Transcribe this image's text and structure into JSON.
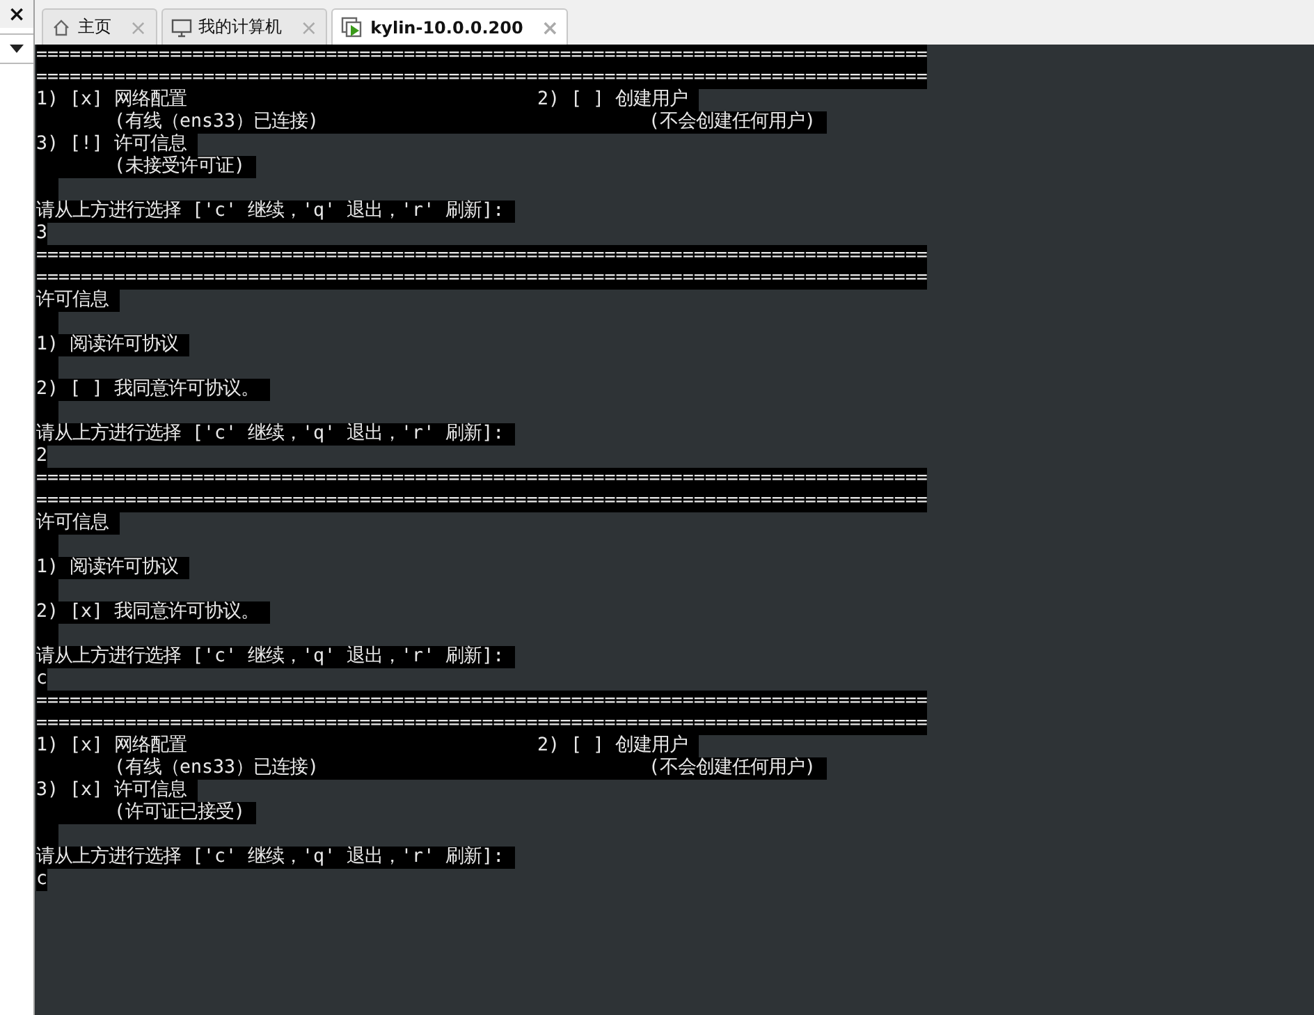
{
  "side_panel": {
    "close": "×"
  },
  "tabs": [
    {
      "label": "主页",
      "selected": false,
      "close": "×"
    },
    {
      "label": "我的计算机",
      "selected": false,
      "close": "×"
    },
    {
      "label": "kylin-10.0.0.200",
      "selected": true,
      "close": "×"
    }
  ],
  "terminal": {
    "lines": [
      {
        "kind": "rule",
        "text": "================================================================================"
      },
      {
        "kind": "rule",
        "text": "================================================================================"
      },
      {
        "kind": "item",
        "text": "1) [x] 网络配置",
        "column_2": "2) [ ] 创建用户"
      },
      {
        "kind": "detail",
        "text": "(有线（ens33）已连接)",
        "column_2": "(不会创建任何用户)"
      },
      {
        "kind": "item",
        "text": "3) [!] 许可信息"
      },
      {
        "kind": "detail",
        "text": "(未接受许可证)"
      },
      {
        "kind": "blank"
      },
      {
        "kind": "text",
        "text": "请从上方进行选择 ['c' 继续，'q' 退出，'r' 刷新]: "
      },
      {
        "kind": "text",
        "text": "3"
      },
      {
        "kind": "rule",
        "text": "================================================================================"
      },
      {
        "kind": "rule",
        "text": "================================================================================"
      },
      {
        "kind": "text",
        "text": "许可信息 "
      },
      {
        "kind": "blank"
      },
      {
        "kind": "text",
        "text": "1) 阅读许可协议 "
      },
      {
        "kind": "blank"
      },
      {
        "kind": "text",
        "text": "2) [ ] 我同意许可协议。 "
      },
      {
        "kind": "blank"
      },
      {
        "kind": "text",
        "text": "请从上方进行选择 ['c' 继续，'q' 退出，'r' 刷新]: "
      },
      {
        "kind": "text",
        "text": "2"
      },
      {
        "kind": "rule",
        "text": "================================================================================"
      },
      {
        "kind": "rule",
        "text": "================================================================================"
      },
      {
        "kind": "text",
        "text": "许可信息 "
      },
      {
        "kind": "blank"
      },
      {
        "kind": "text",
        "text": "1) 阅读许可协议 "
      },
      {
        "kind": "blank"
      },
      {
        "kind": "text",
        "text": "2) [x] 我同意许可协议。 "
      },
      {
        "kind": "blank"
      },
      {
        "kind": "text",
        "text": "请从上方进行选择 ['c' 继续，'q' 退出，'r' 刷新]: "
      },
      {
        "kind": "text",
        "text": "c"
      },
      {
        "kind": "rule",
        "text": "================================================================================"
      },
      {
        "kind": "rule",
        "text": "================================================================================"
      },
      {
        "kind": "item",
        "text": "1) [x] 网络配置",
        "column_2": "2) [ ] 创建用户"
      },
      {
        "kind": "detail",
        "text": "(有线（ens33）已连接)",
        "column_2": "(不会创建任何用户)"
      },
      {
        "kind": "item",
        "text": "3) [x] 许可信息"
      },
      {
        "kind": "detail",
        "text": "(许可证已接受)"
      },
      {
        "kind": "blank"
      },
      {
        "kind": "text",
        "text": "请从上方进行选择 ['c' 继续，'q' 退出，'r' 刷新]: "
      },
      {
        "kind": "text",
        "text": "c"
      }
    ]
  }
}
